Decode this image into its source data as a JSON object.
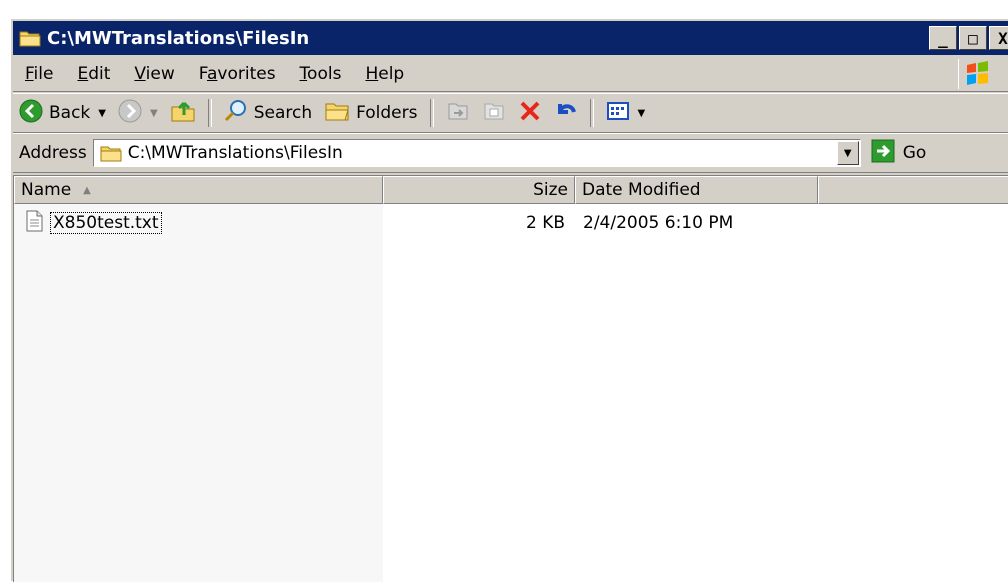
{
  "window": {
    "title": "C:\\MWTranslations\\FilesIn",
    "controls": {
      "minimize": "_",
      "maximize": "□",
      "close": "X"
    }
  },
  "menu": {
    "items": [
      {
        "label": "File",
        "access": "F"
      },
      {
        "label": "Edit",
        "access": "E"
      },
      {
        "label": "View",
        "access": "V"
      },
      {
        "label": "Favorites",
        "access": "a"
      },
      {
        "label": "Tools",
        "access": "T"
      },
      {
        "label": "Help",
        "access": "H"
      }
    ]
  },
  "toolbar": {
    "back_label": "Back",
    "search_label": "Search",
    "folders_label": "Folders"
  },
  "address": {
    "label": "Address",
    "value": "C:\\MWTranslations\\FilesIn",
    "go_label": "Go"
  },
  "list": {
    "columns": {
      "name": "Name",
      "size": "Size",
      "date": "Date Modified"
    },
    "rows": [
      {
        "name": "X850test.txt",
        "size": "2 KB",
        "date": "2/4/2005 6:10 PM"
      }
    ]
  },
  "colors": {
    "titlebar": "#0a246a",
    "face": "#d4d0c8",
    "delete_red": "#e8261a",
    "go_green": "#2e9b2e"
  },
  "icons": [
    "folder-icon",
    "back-icon",
    "forward-icon",
    "up-folder-icon",
    "search-icon",
    "folders-icon",
    "move-to-icon",
    "copy-to-icon",
    "delete-icon",
    "undo-icon",
    "views-icon",
    "go-arrow-icon",
    "text-file-icon",
    "windows-logo-icon"
  ]
}
